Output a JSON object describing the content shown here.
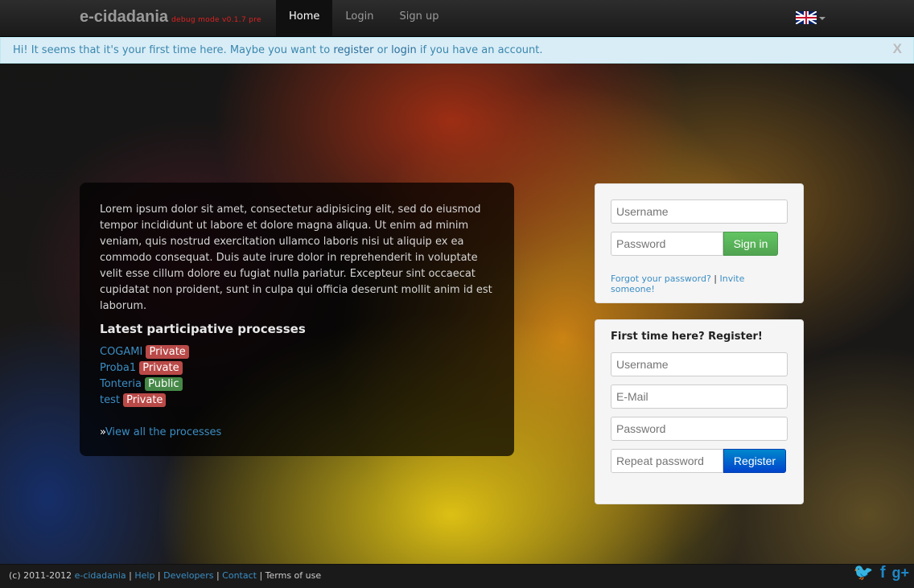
{
  "header": {
    "brand": "e-cidadania",
    "debug": "debug mode v0.1.7 pre",
    "nav": [
      {
        "label": "Home",
        "active": true
      },
      {
        "label": "Login",
        "active": false
      },
      {
        "label": "Sign up",
        "active": false
      }
    ],
    "language": "en-gb-flag-icon"
  },
  "alert": {
    "text_1": "Hi! It seems that it's your first time here. Maybe you want to ",
    "register_link": "register",
    "text_2": " or ",
    "login_link": "login",
    "text_3": " if you have an account.",
    "close": "X"
  },
  "intro": {
    "paragraph": "Lorem ipsum dolor sit amet, consectetur adipisicing elit, sed do eiusmod tempor incididunt ut labore et dolore magna aliqua. Ut enim ad minim veniam, quis nostrud exercitation ullamco laboris nisi ut aliquip ex ea commodo consequat. Duis aute irure dolor in reprehenderit in voluptate velit esse cillum dolore eu fugiat nulla pariatur. Excepteur sint occaecat cupidatat non proident, sunt in culpa qui officia deserunt mollit anim id est laborum.",
    "heading": "Latest participative processes",
    "processes": [
      {
        "name": "COGAMI",
        "visibility": "Private"
      },
      {
        "name": "Proba1",
        "visibility": "Private"
      },
      {
        "name": "Tonteria",
        "visibility": "Public"
      },
      {
        "name": "test",
        "visibility": "Private"
      }
    ],
    "view_all_prefix": "»",
    "view_all": "View all the processes"
  },
  "login": {
    "username_placeholder": "Username",
    "password_placeholder": "Password",
    "signin": "Sign in",
    "forgot": "Forgot your password?",
    "separator": " | ",
    "invite": "Invite someone!"
  },
  "register": {
    "title": "First time here? Register!",
    "username_placeholder": "Username",
    "email_placeholder": "E-Mail",
    "password_placeholder": "Password",
    "repeat_placeholder": "Repeat password",
    "button": "Register"
  },
  "footer": {
    "copyright": "(c) 2011-2012 ",
    "brand_link": "e-cidadania",
    "sep": " | ",
    "help": "Help",
    "developers": "Developers",
    "contact": "Contact",
    "terms": "Terms of use",
    "social": [
      "twitter-icon",
      "facebook-icon",
      "google-plus-icon"
    ]
  },
  "colors": {
    "private": "#b94a48",
    "public": "#468847",
    "link": "#3b8ec4",
    "alert_bg": "#d9edf7"
  }
}
